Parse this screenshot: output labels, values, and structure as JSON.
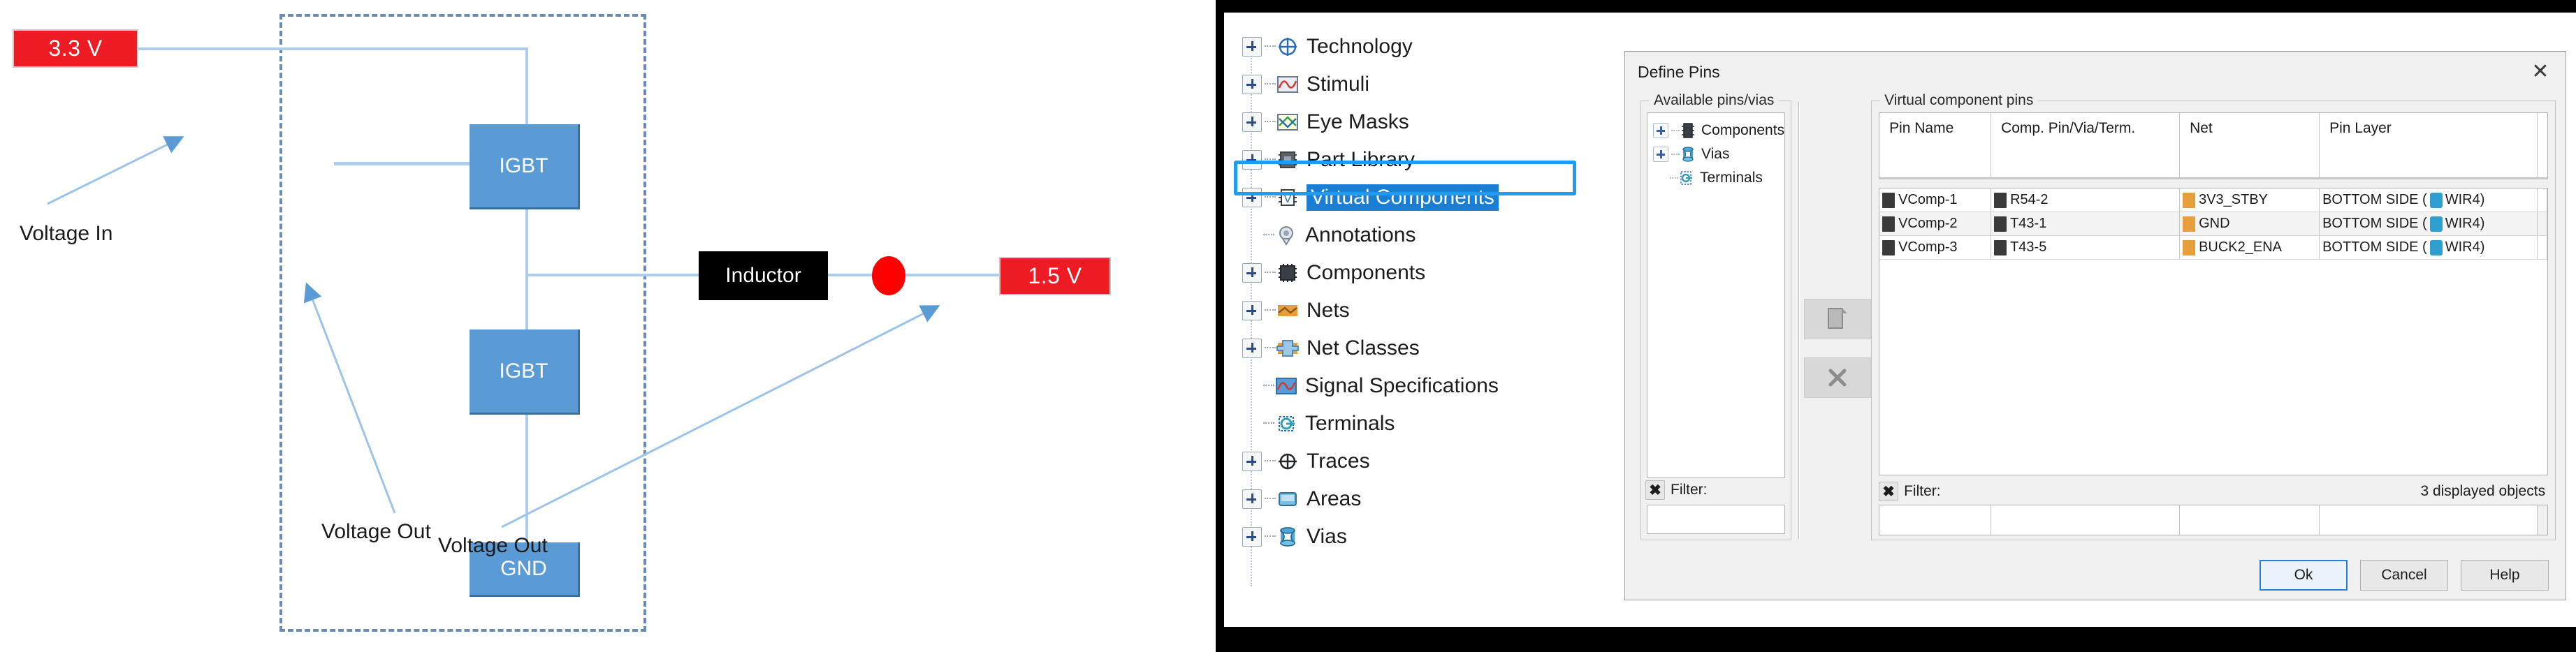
{
  "diagram": {
    "voltage_in_box": "3.3 V",
    "voltage_out_box": "1.5 V",
    "inductor_label": "Inductor",
    "igbt_top_label": "IGBT",
    "igbt_mid_label": "IGBT",
    "gnd_label": "GND",
    "annotation_voltage_in": "Voltage In",
    "annotation_voltage_out_1": "Voltage Out",
    "annotation_voltage_out_2": "Voltage Out",
    "colors": {
      "supply_box": "#ed1c24",
      "block": "#5b9bd5",
      "wire": "#aecdec",
      "inductor": "#000000",
      "node_dot": "#ff0000",
      "boundary": "#6a8bb5"
    }
  },
  "tree": {
    "items": [
      {
        "label": "Technology",
        "icon": "technology-icon",
        "expandable": true,
        "selected": false
      },
      {
        "label": "Stimuli",
        "icon": "stimuli-icon",
        "expandable": true,
        "selected": false
      },
      {
        "label": "Eye Masks",
        "icon": "eye-masks-icon",
        "expandable": true,
        "selected": false
      },
      {
        "label": "Part Library",
        "icon": "part-library-icon",
        "expandable": true,
        "selected": false
      },
      {
        "label": "Virtual Components",
        "icon": "virtual-components-icon",
        "expandable": true,
        "selected": true
      },
      {
        "label": "Annotations",
        "icon": "annotations-icon",
        "expandable": false,
        "selected": false
      },
      {
        "label": "Components",
        "icon": "components-icon",
        "expandable": true,
        "selected": false
      },
      {
        "label": "Nets",
        "icon": "nets-icon",
        "expandable": true,
        "selected": false
      },
      {
        "label": "Net Classes",
        "icon": "net-classes-icon",
        "expandable": true,
        "selected": false
      },
      {
        "label": "Signal Specifications",
        "icon": "signal-specifications-icon",
        "expandable": false,
        "selected": false
      },
      {
        "label": "Terminals",
        "icon": "terminals-icon",
        "expandable": false,
        "selected": false
      },
      {
        "label": "Traces",
        "icon": "traces-icon",
        "expandable": true,
        "selected": false
      },
      {
        "label": "Areas",
        "icon": "areas-icon",
        "expandable": true,
        "selected": false
      },
      {
        "label": "Vias",
        "icon": "vias-icon",
        "expandable": true,
        "selected": false
      }
    ]
  },
  "dialog": {
    "title": "Define Pins",
    "close_glyph": "✕",
    "available_group_title": "Available pins/vias",
    "available_tree": [
      {
        "label": "Components",
        "icon": "chip-icon",
        "expandable": true
      },
      {
        "label": "Vias",
        "icon": "via-icon",
        "expandable": true
      },
      {
        "label": "Terminals",
        "icon": "terminal-icon",
        "expandable": false
      }
    ],
    "available_filter": {
      "x_glyph": "✖",
      "label": "Filter:",
      "value": "",
      "placeholder": ""
    },
    "actions": [
      {
        "name": "add-pin-button",
        "glyph": "⎘"
      },
      {
        "name": "remove-pin-button",
        "glyph": "✕"
      }
    ],
    "vcp_group_title": "Virtual component pins",
    "columns": [
      "Pin Name",
      "Comp. Pin/Via/Term.",
      "Net",
      "Pin Layer"
    ],
    "rows": [
      {
        "pin_name": "VComp-1",
        "comp_pin": "R54-2",
        "net": "3V3_STBY",
        "pin_layer": "BOTTOM SIDE (",
        "pin_layer_tail": "WIR4)"
      },
      {
        "pin_name": "VComp-2",
        "comp_pin": "T43-1",
        "net": "GND",
        "pin_layer": "BOTTOM SIDE (",
        "pin_layer_tail": "WIR4)"
      },
      {
        "pin_name": "VComp-3",
        "comp_pin": "T43-5",
        "net": "BUCK2_ENA",
        "pin_layer": "BOTTOM SIDE (",
        "pin_layer_tail": "WIR4)"
      }
    ],
    "vcp_filter": {
      "x_glyph": "✖",
      "label": "Filter:"
    },
    "vcp_filter_values": [
      "",
      "",
      "",
      ""
    ],
    "displayed_objects": "3 displayed objects",
    "buttons": [
      {
        "label": "Ok",
        "default": true
      },
      {
        "label": "Cancel",
        "default": false
      },
      {
        "label": "Help",
        "default": false
      }
    ]
  }
}
